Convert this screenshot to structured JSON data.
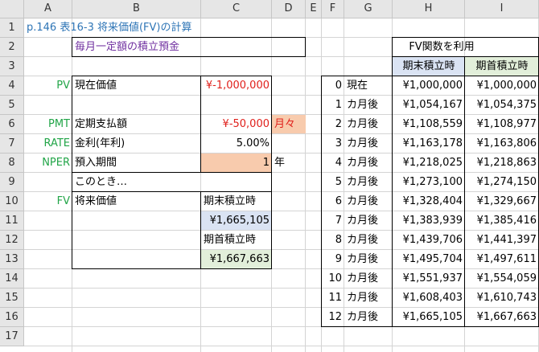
{
  "column_headers": [
    "A",
    "B",
    "C",
    "D",
    "E",
    "F",
    "G",
    "H",
    "I"
  ],
  "row_numbers": [
    "1",
    "2",
    "3",
    "4",
    "5",
    "6",
    "7",
    "8",
    "9",
    "10",
    "11",
    "12",
    "13",
    "14",
    "15",
    "16",
    "17"
  ],
  "sheet": {
    "title": "p.146 表16-3 将来価値(FV)の計算",
    "subtitle": "毎月一定額の積立預金",
    "pv": {
      "label": "PV",
      "name": "現在価値",
      "value": "¥-1,000,000"
    },
    "pmt": {
      "label": "PMT",
      "name": "定期支払額",
      "value": "¥-50,000",
      "unit": "月々"
    },
    "rate": {
      "label": "RATE",
      "name": "金利(年利)",
      "value": "5.00%"
    },
    "nper": {
      "label": "NPER",
      "name": "預入期間",
      "value": "1",
      "unit": "年"
    },
    "note": "このとき…",
    "fv": {
      "label": "FV",
      "name": "将来価値",
      "end_label": "期末積立時",
      "end_value": "¥1,665,105",
      "begin_label": "期首積立時",
      "begin_value": "¥1,667,663"
    }
  },
  "fv_table": {
    "title": "FV関数を利用",
    "col_end": "期末積立時",
    "col_begin": "期首積立時",
    "rows": [
      {
        "n": "0",
        "label": "現在",
        "end": "¥1,000,000",
        "begin": "¥1,000,000"
      },
      {
        "n": "1",
        "label": "カ月後",
        "end": "¥1,054,167",
        "begin": "¥1,054,375"
      },
      {
        "n": "2",
        "label": "カ月後",
        "end": "¥1,108,559",
        "begin": "¥1,108,977"
      },
      {
        "n": "3",
        "label": "カ月後",
        "end": "¥1,163,178",
        "begin": "¥1,163,806"
      },
      {
        "n": "4",
        "label": "カ月後",
        "end": "¥1,218,025",
        "begin": "¥1,218,863"
      },
      {
        "n": "5",
        "label": "カ月後",
        "end": "¥1,273,100",
        "begin": "¥1,274,150"
      },
      {
        "n": "6",
        "label": "カ月後",
        "end": "¥1,328,404",
        "begin": "¥1,329,667"
      },
      {
        "n": "7",
        "label": "カ月後",
        "end": "¥1,383,939",
        "begin": "¥1,385,416"
      },
      {
        "n": "8",
        "label": "カ月後",
        "end": "¥1,439,706",
        "begin": "¥1,441,397"
      },
      {
        "n": "9",
        "label": "カ月後",
        "end": "¥1,495,704",
        "begin": "¥1,497,611"
      },
      {
        "n": "10",
        "label": "カ月後",
        "end": "¥1,551,937",
        "begin": "¥1,554,059"
      },
      {
        "n": "11",
        "label": "カ月後",
        "end": "¥1,608,403",
        "begin": "¥1,610,743"
      },
      {
        "n": "12",
        "label": "カ月後",
        "end": "¥1,665,105",
        "begin": "¥1,667,663"
      }
    ]
  },
  "colors": {
    "label_green": "#22a548",
    "negative_red": "#e0201b",
    "title_blue": "#2e75b6",
    "subtitle_purple": "#7030a0",
    "input_fill": "#f8cbad",
    "end_fill": "#dae3f3",
    "begin_fill": "#e2efda"
  }
}
